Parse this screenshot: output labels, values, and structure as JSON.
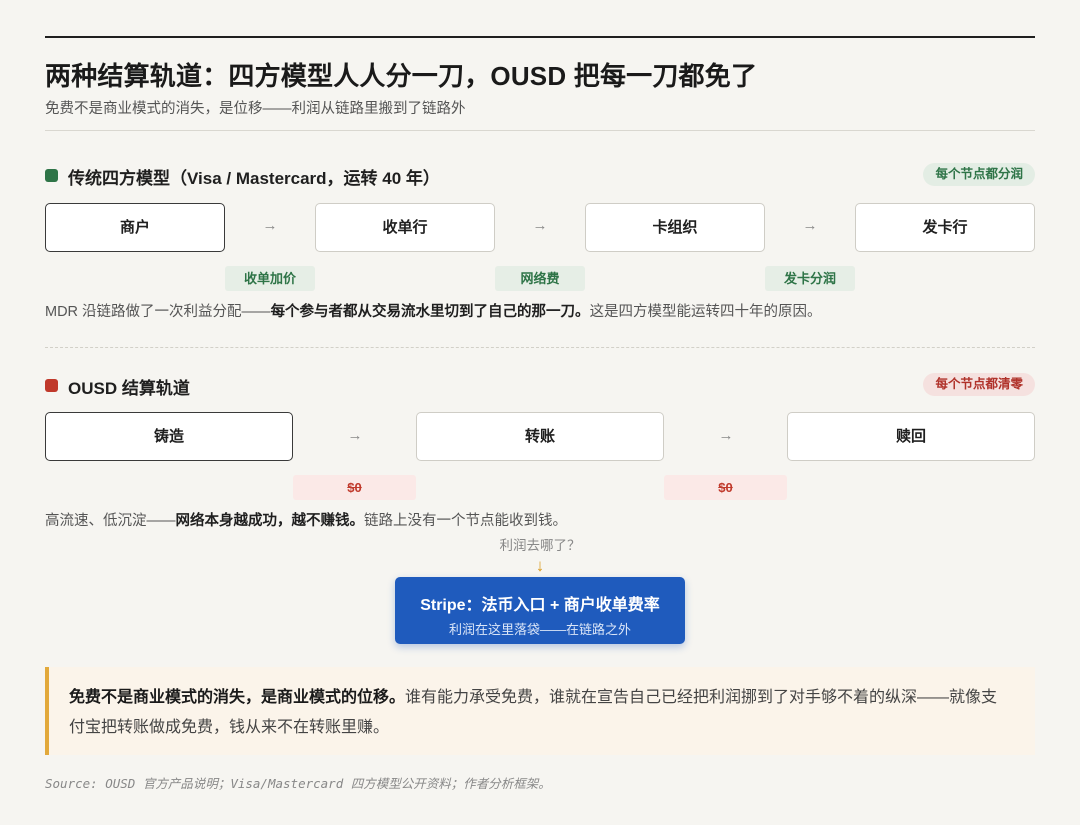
{
  "header": {
    "title": "两种结算轨道：四方模型人人分一刀，OUSD 把每一刀都免了",
    "subtitle": "免费不是商业模式的消失，是位移——利润从链路里搬到了链路外"
  },
  "traditional": {
    "label": "传统四方模型（Visa / Mastercard，运转 40 年）",
    "badge": "每个节点都分润",
    "accent": "#2e7447",
    "nodes": [
      "商户",
      "收单行",
      "卡组织",
      "发卡行"
    ],
    "arrow": "→",
    "fees": [
      "收单加价",
      "网络费",
      "发卡分润"
    ],
    "note_prefix": "MDR 沿链路做了一次利益分配——",
    "note_bold": "每个参与者都从交易流水里切到了自己的那一刀。",
    "note_suffix": "这是四方模型能运转四十年的原因。"
  },
  "ousd": {
    "label": "OUSD 结算轨道",
    "badge": "每个节点都清零",
    "accent": "#c0392b",
    "nodes": [
      "铸造",
      "转账",
      "赎回"
    ],
    "arrow": "→",
    "fees": [
      "$0",
      "$0"
    ],
    "note_prefix": "高流速、低沉淀——",
    "note_bold": "网络本身越成功，越不赚钱。",
    "note_suffix": "链路上没有一个节点能收到钱。"
  },
  "profit": {
    "question": "利润去哪了？",
    "arrow": "↓",
    "box_title": "Stripe：法币入口 + 商户收单费率",
    "box_sub": "利润在这里落袋——在链路之外"
  },
  "callout": {
    "bold": "免费不是商业模式的消失，是商业模式的位移。",
    "text": "谁有能力承受免费，谁就在宣告自己已经把利润挪到了对手够不着的纵深——就像支付宝把转账做成免费，钱从来不在转账里赚。"
  },
  "source": "Source: OUSD 官方产品说明；Visa/Mastercard 四方模型公开资料；作者分析框架。",
  "colors": {
    "accent_blue": "#1f5bbd",
    "highlight_gold": "#e2a93b"
  }
}
